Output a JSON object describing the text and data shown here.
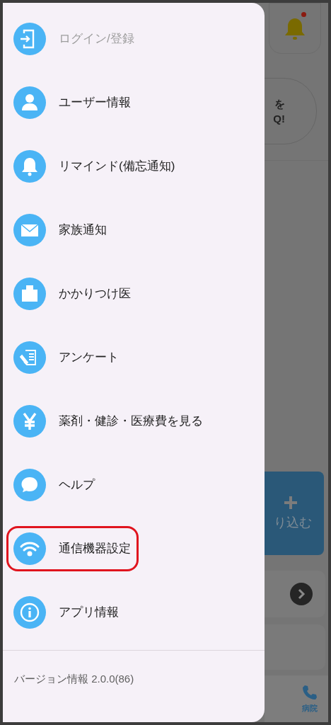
{
  "drawer": {
    "items": [
      {
        "kind": "login",
        "label": "ログイン/登録",
        "disabled": true,
        "highlighted": false
      },
      {
        "kind": "user",
        "label": "ユーザー情報",
        "disabled": false,
        "highlighted": false
      },
      {
        "kind": "bell",
        "label": "リマインド(備忘通知)",
        "disabled": false,
        "highlighted": false
      },
      {
        "kind": "mail",
        "label": "家族通知",
        "disabled": false,
        "highlighted": false
      },
      {
        "kind": "building",
        "label": "かかりつけ医",
        "disabled": false,
        "highlighted": false
      },
      {
        "kind": "survey",
        "label": "アンケート",
        "disabled": false,
        "highlighted": false
      },
      {
        "kind": "yen",
        "label": "薬剤・健診・医療費を見る",
        "disabled": false,
        "highlighted": false
      },
      {
        "kind": "chat",
        "label": "ヘルプ",
        "disabled": false,
        "highlighted": false
      },
      {
        "kind": "wifi",
        "label": "通信機器設定",
        "disabled": false,
        "highlighted": true
      },
      {
        "kind": "info",
        "label": "アプリ情報",
        "disabled": false,
        "highlighted": false
      }
    ],
    "version": "バージョン情報 2.0.0(86)"
  },
  "background": {
    "card_lines": [
      "を",
      "Q!"
    ],
    "import_label": "り込む",
    "nav_label": "病院",
    "notification_dot": true
  }
}
